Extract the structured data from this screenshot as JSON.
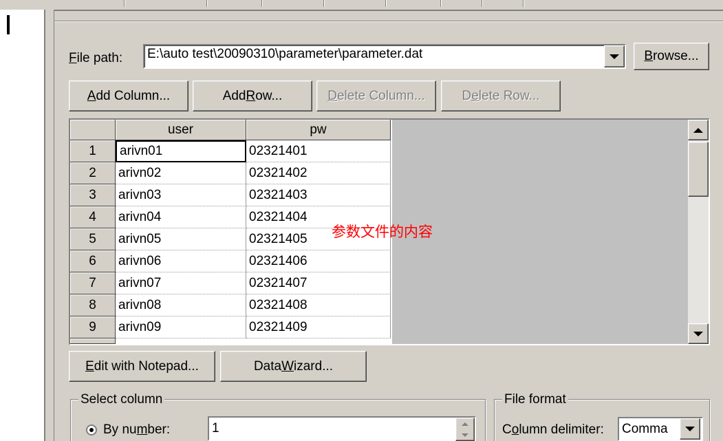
{
  "file_path": {
    "label_prefix": "",
    "label_key": "F",
    "label_rest": "ile path:",
    "value": "E:\\auto test\\20090310\\parameter\\parameter.dat",
    "browse_key": "B",
    "browse_rest": "rowse..."
  },
  "toolbar": {
    "add_column_key": "A",
    "add_column_rest": "dd Column...",
    "add_row_pre": "Add ",
    "add_row_key": "R",
    "add_row_rest": "ow...",
    "delete_column_key": "D",
    "delete_column_rest": "elete Column...",
    "delete_row_pre": "D",
    "delete_row_key": "e",
    "delete_row_rest": "lete Row..."
  },
  "grid": {
    "columns": [
      "user",
      "pw"
    ],
    "rows": [
      {
        "num": "1",
        "user": "arivn01",
        "pw": "02321401"
      },
      {
        "num": "2",
        "user": "arivn02",
        "pw": "02321402"
      },
      {
        "num": "3",
        "user": "arivn03",
        "pw": "02321403"
      },
      {
        "num": "4",
        "user": "arivn04",
        "pw": "02321404"
      },
      {
        "num": "5",
        "user": "arivn05",
        "pw": "02321405"
      },
      {
        "num": "6",
        "user": "arivn06",
        "pw": "02321406"
      },
      {
        "num": "7",
        "user": "arivn07",
        "pw": "02321407"
      },
      {
        "num": "8",
        "user": "arivn08",
        "pw": "02321408"
      },
      {
        "num": "9",
        "user": "arivn09",
        "pw": "02321409"
      }
    ]
  },
  "annotation": "参数文件的内容",
  "actions": {
    "edit_notepad_key": "E",
    "edit_notepad_rest": "dit with Notepad...",
    "data_wizard_pre": "Data ",
    "data_wizard_key": "W",
    "data_wizard_rest": "izard..."
  },
  "select_column": {
    "title": "Select column",
    "by_number_pre": "By nu",
    "by_number_key": "m",
    "by_number_rest": "ber:",
    "number_value": "1"
  },
  "file_format": {
    "title": "File format",
    "delimiter_pre": "C",
    "delimiter_key": "o",
    "delimiter_rest": "lumn delimiter:",
    "delimiter_value": "Comma"
  },
  "icons": {
    "dropdown": "chevron-down-icon",
    "scroll_up": "scroll-up-icon",
    "scroll_down": "scroll-down-icon"
  },
  "colors": {
    "background": "#d4d0c8",
    "annotation": "#ff0000"
  }
}
